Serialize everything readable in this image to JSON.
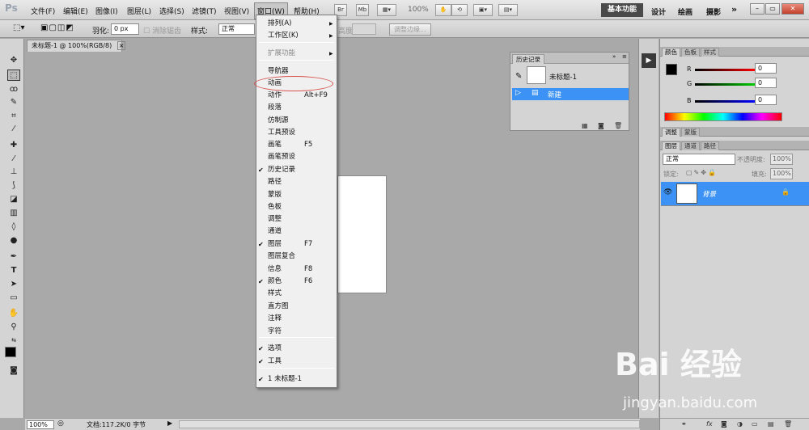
{
  "app": {
    "logo": "Ps"
  },
  "menubar": {
    "items": [
      "文件(F)",
      "编辑(E)",
      "图像(I)",
      "图层(L)",
      "选择(S)",
      "滤镜(T)",
      "视图(V)",
      "窗口(W)",
      "帮助(H)"
    ],
    "br_label": "Br",
    "mb_label": "Mb",
    "zoom": "100%"
  },
  "workspace": {
    "active": "基本功能",
    "items": [
      "设计",
      "绘画",
      "摄影"
    ],
    "more": "»"
  },
  "options": {
    "feather_label": "羽化:",
    "feather_value": "0 px",
    "antialias_label": "消除锯齿",
    "style_label": "样式:",
    "style_value": "正常",
    "height_label": "高度:",
    "refine_edge": "调整边缘..."
  },
  "document": {
    "tab_title": "未标题-1 @ 100%(RGB/8)",
    "tab_close": "×"
  },
  "status": {
    "zoom": "100%",
    "doc_info": "文档:117.2K/0 字节"
  },
  "window_menu": {
    "items": [
      {
        "label": "排列(A)",
        "shortcut": "",
        "checked": false,
        "submenu": true,
        "disabled": false
      },
      {
        "label": "工作区(K)",
        "shortcut": "",
        "checked": false,
        "submenu": true,
        "disabled": false
      },
      {
        "label": "扩展功能",
        "shortcut": "",
        "checked": false,
        "submenu": true,
        "disabled": true
      },
      {
        "label": "导航器",
        "shortcut": "",
        "checked": false,
        "submenu": false,
        "disabled": false
      },
      {
        "label": "动画",
        "shortcut": "",
        "checked": false,
        "submenu": false,
        "disabled": false
      },
      {
        "label": "动作",
        "shortcut": "Alt+F9",
        "checked": false,
        "submenu": false,
        "disabled": false
      },
      {
        "label": "段落",
        "shortcut": "",
        "checked": false,
        "submenu": false,
        "disabled": false
      },
      {
        "label": "仿制源",
        "shortcut": "",
        "checked": false,
        "submenu": false,
        "disabled": false
      },
      {
        "label": "工具预设",
        "shortcut": "",
        "checked": false,
        "submenu": false,
        "disabled": false
      },
      {
        "label": "画笔",
        "shortcut": "F5",
        "checked": false,
        "submenu": false,
        "disabled": false
      },
      {
        "label": "画笔预设",
        "shortcut": "",
        "checked": false,
        "submenu": false,
        "disabled": false
      },
      {
        "label": "历史记录",
        "shortcut": "",
        "checked": true,
        "submenu": false,
        "disabled": false
      },
      {
        "label": "路径",
        "shortcut": "",
        "checked": false,
        "submenu": false,
        "disabled": false
      },
      {
        "label": "蒙版",
        "shortcut": "",
        "checked": false,
        "submenu": false,
        "disabled": false
      },
      {
        "label": "色板",
        "shortcut": "",
        "checked": false,
        "submenu": false,
        "disabled": false
      },
      {
        "label": "调整",
        "shortcut": "",
        "checked": false,
        "submenu": false,
        "disabled": false
      },
      {
        "label": "通道",
        "shortcut": "",
        "checked": false,
        "submenu": false,
        "disabled": false
      },
      {
        "label": "图层",
        "shortcut": "F7",
        "checked": true,
        "submenu": false,
        "disabled": false
      },
      {
        "label": "图层复合",
        "shortcut": "",
        "checked": false,
        "submenu": false,
        "disabled": false
      },
      {
        "label": "信息",
        "shortcut": "F8",
        "checked": false,
        "submenu": false,
        "disabled": false
      },
      {
        "label": "颜色",
        "shortcut": "F6",
        "checked": true,
        "submenu": false,
        "disabled": false
      },
      {
        "label": "样式",
        "shortcut": "",
        "checked": false,
        "submenu": false,
        "disabled": false
      },
      {
        "label": "直方图",
        "shortcut": "",
        "checked": false,
        "submenu": false,
        "disabled": false
      },
      {
        "label": "注释",
        "shortcut": "",
        "checked": false,
        "submenu": false,
        "disabled": false
      },
      {
        "label": "字符",
        "shortcut": "",
        "checked": false,
        "submenu": false,
        "disabled": false
      },
      {
        "label": "选项",
        "shortcut": "",
        "checked": true,
        "submenu": false,
        "disabled": false
      },
      {
        "label": "工具",
        "shortcut": "",
        "checked": true,
        "submenu": false,
        "disabled": false
      },
      {
        "label": "1 未标题-1",
        "shortcut": "",
        "checked": true,
        "submenu": false,
        "disabled": false
      }
    ]
  },
  "history": {
    "tab": "历史记录",
    "snapshot": "未标题-1",
    "state": "新建"
  },
  "color_panel": {
    "tabs": [
      "颜色",
      "色板",
      "样式"
    ],
    "r_label": "R",
    "g_label": "G",
    "b_label": "B",
    "r": "0",
    "g": "0",
    "b": "0"
  },
  "adjust_panel": {
    "tabs": [
      "调整",
      "蒙版"
    ]
  },
  "layers_panel": {
    "tabs": [
      "图层",
      "通道",
      "路径"
    ],
    "blend_mode": "正常",
    "opacity_label": "不透明度:",
    "opacity": "100%",
    "lock_label": "锁定:",
    "fill_label": "填充:",
    "fill": "100%",
    "layer_name": "背景"
  },
  "watermark": {
    "brand": "Bai 经验",
    "url": "jingyan.baidu.com"
  }
}
